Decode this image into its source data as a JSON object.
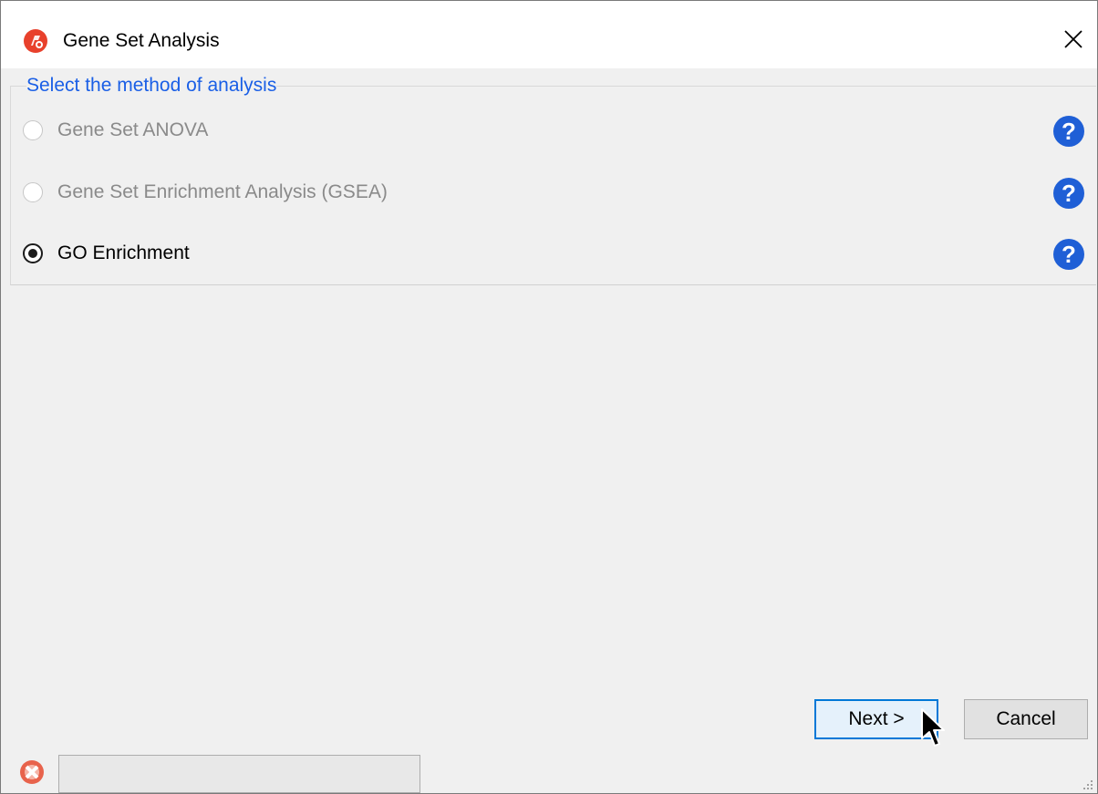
{
  "window": {
    "title": "Gene Set Analysis",
    "app_icon": "partek-logo-icon",
    "close_icon": "close-icon"
  },
  "group": {
    "legend": "Select the method of analysis"
  },
  "options": [
    {
      "label": "Gene Set ANOVA",
      "selected": false,
      "enabled": false
    },
    {
      "label": "Gene Set Enrichment Analysis (GSEA)",
      "selected": false,
      "enabled": false
    },
    {
      "label": "GO Enrichment",
      "selected": true,
      "enabled": true
    }
  ],
  "help_icon": "question-circle-icon",
  "buttons": {
    "next_label": "Next >",
    "cancel_label": "Cancel"
  },
  "status": {
    "icon": "error-circle-icon",
    "text": ""
  },
  "colors": {
    "legend_text": "#1a5fe6",
    "help_icon_fill": "#1f5fd6",
    "app_icon_fill": "#e8412c",
    "next_border": "#0078d7",
    "status_icon_fill": "#e8634c"
  }
}
